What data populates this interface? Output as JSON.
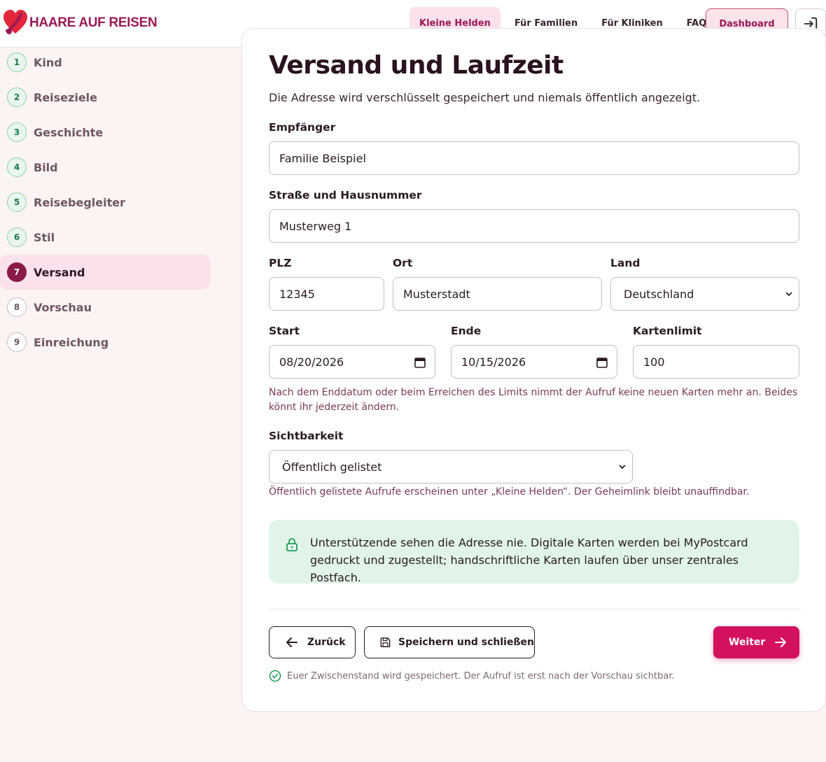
{
  "header": {
    "logo_text": "HAARE AUF REISEN",
    "nav": [
      {
        "label": "Kleine Helden",
        "active": true
      },
      {
        "label": "Für Familien",
        "active": false
      },
      {
        "label": "Für Kliniken",
        "active": false
      },
      {
        "label": "FAQ",
        "active": false
      }
    ],
    "dashboard_label": "Dashboard",
    "login_icon": "login-icon"
  },
  "sidebar": {
    "steps": [
      {
        "num": "1",
        "label": "Kind",
        "state": "done"
      },
      {
        "num": "2",
        "label": "Reiseziele",
        "state": "done"
      },
      {
        "num": "3",
        "label": "Geschichte",
        "state": "done"
      },
      {
        "num": "4",
        "label": "Bild",
        "state": "done"
      },
      {
        "num": "5",
        "label": "Reisebegleiter",
        "state": "done"
      },
      {
        "num": "6",
        "label": "Stil",
        "state": "done"
      },
      {
        "num": "7",
        "label": "Versand",
        "state": "current"
      },
      {
        "num": "8",
        "label": "Vorschau",
        "state": "todo"
      },
      {
        "num": "9",
        "label": "Einreichung",
        "state": "todo"
      }
    ]
  },
  "form": {
    "title": "Versand und Laufzeit",
    "subtitle": "Die Adresse wird verschlüsselt gespeichert und niemals öffentlich angezeigt.",
    "recipient": {
      "label": "Empfänger",
      "value": "Familie Beispiel"
    },
    "street": {
      "label": "Straße und Hausnummer",
      "value": "Musterweg 1"
    },
    "zip": {
      "label": "PLZ",
      "value": "12345"
    },
    "city": {
      "label": "Ort",
      "value": "Musterstadt"
    },
    "country": {
      "label": "Land",
      "value": "Deutschland"
    },
    "start": {
      "label": "Start",
      "value": "08/20/2026"
    },
    "end": {
      "label": "Ende",
      "value": "10/15/2026"
    },
    "limit": {
      "label": "Kartenlimit",
      "value": "100"
    },
    "limit_help": "Nach dem Enddatum oder beim Erreichen des Limits nimmt der Aufruf keine neuen Karten mehr an. Beides könnt ihr jederzeit ändern.",
    "visibility": {
      "label": "Sichtbarkeit",
      "value": "Öffentlich gelistet"
    },
    "visibility_help": "Öffentlich gelistete Aufrufe erscheinen unter „Kleine Helden“. Der Geheimlink bleibt unauffindbar.",
    "notice": "Unterstützende sehen die Adresse nie. Digitale Karten werden bei MyPostcard gedruckt und zugestellt; handschriftliche Karten laufen über unser zentrales Postfach.",
    "back_label": "Zurück",
    "save_label": "Speichern und schließen",
    "next_label": "Weiter",
    "footnote": "Euer Zwischenstand wird gespeichert. Der Aufruf ist erst nach der Vorschau sichtbar."
  },
  "colors": {
    "brand": "#d4115f",
    "brand_dark": "#9a1a55",
    "success_bg": "#e1f4e8",
    "success": "#1e7a4a"
  }
}
